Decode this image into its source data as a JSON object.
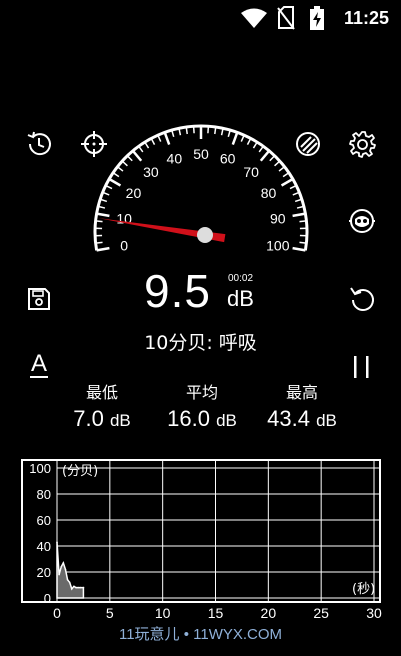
{
  "status": {
    "time": "11:25"
  },
  "meter": {
    "reading": "9.5",
    "unit": "dB",
    "timer": "00:02",
    "description": "10分贝: 呼吸",
    "needle_db": 9.5,
    "gauge_labels": [
      "0",
      "10",
      "20",
      "30",
      "40",
      "50",
      "60",
      "70",
      "80",
      "90",
      "100"
    ]
  },
  "stats": {
    "min": {
      "label": "最低",
      "value": "7.0",
      "unit": "dB"
    },
    "avg": {
      "label": "平均",
      "value": "16.0",
      "unit": "dB"
    },
    "max": {
      "label": "最高",
      "value": "43.4",
      "unit": "dB"
    }
  },
  "toolbar": {
    "weighting": "A",
    "pause_label": "II"
  },
  "icons": {
    "left": [
      "history-icon",
      "target-icon",
      "save-icon",
      "weighting-icon"
    ],
    "right": [
      "theme-icon",
      "settings-icon",
      "calibration-icon",
      "reset-icon",
      "pause-icon"
    ]
  },
  "chart_data": {
    "type": "area",
    "ylabel": "(分贝)",
    "xlabel": "(秒)",
    "ylim": [
      0,
      100
    ],
    "xlim": [
      0,
      30
    ],
    "y_ticks": [
      "100",
      "80",
      "60",
      "40",
      "20",
      "0"
    ],
    "y_tick_values": [
      100,
      80,
      60,
      40,
      20,
      0
    ],
    "x_ticks": [
      "0",
      "5",
      "10",
      "15",
      "20",
      "25",
      "30"
    ],
    "x_tick_values": [
      0,
      5,
      10,
      15,
      20,
      25,
      30
    ],
    "x": [
      0,
      0.2,
      0.4,
      0.6,
      0.8,
      1.0,
      1.2,
      1.4,
      1.6,
      1.8,
      2.0,
      2.2,
      2.5
    ],
    "y": [
      43,
      18,
      24,
      27,
      22,
      14,
      12,
      7,
      9,
      8,
      8,
      8,
      8
    ],
    "grid": true
  },
  "footer": "11玩意儿 • 11WYX.COM"
}
